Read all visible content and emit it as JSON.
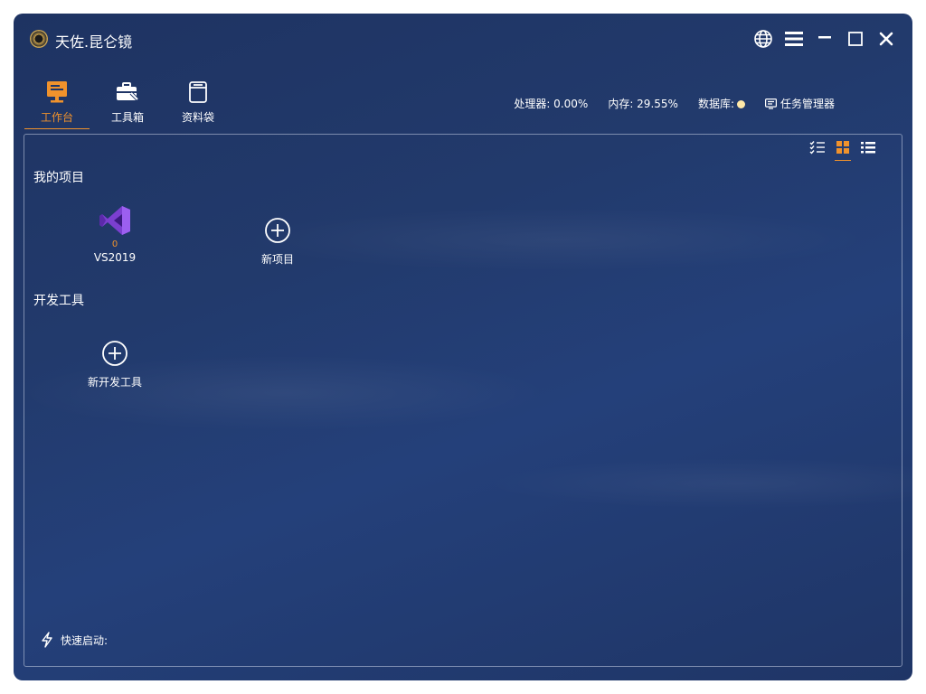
{
  "window": {
    "title": "天佐.昆仑镜"
  },
  "nav": {
    "items": [
      {
        "label": "工作台",
        "icon": "workbench-icon",
        "active": true
      },
      {
        "label": "工具箱",
        "icon": "toolbox-icon",
        "active": false
      },
      {
        "label": "资料袋",
        "icon": "folder-bag-icon",
        "active": false
      }
    ]
  },
  "status": {
    "cpu": "处理器: 0.00%",
    "memory": "内存: 29.55%",
    "database": "数据库:",
    "task_manager": "任务管理器"
  },
  "sections": {
    "projects_title": "我的项目",
    "projects": [
      {
        "name": "VS2019",
        "count": "0",
        "icon": "visual-studio-icon"
      }
    ],
    "new_project": "新项目",
    "devtools_title": "开发工具",
    "new_devtool": "新开发工具"
  },
  "quick_launch": {
    "label": "快速启动:"
  },
  "colors": {
    "accent": "#f0922c",
    "background": "#22396a",
    "text": "#ffffff"
  }
}
